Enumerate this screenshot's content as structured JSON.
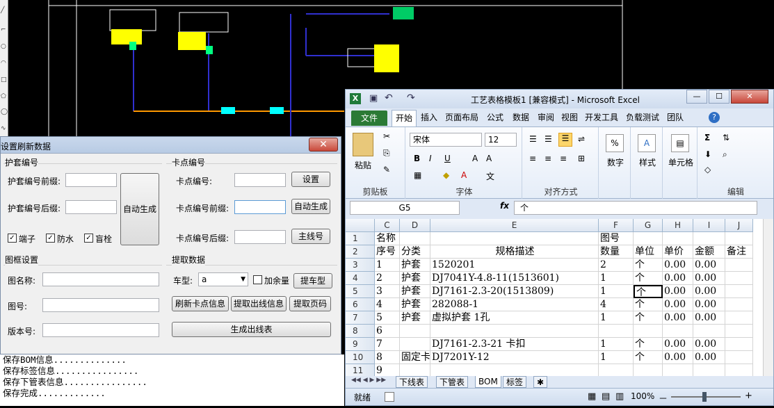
{
  "dialog": {
    "title": "设置刷新数据",
    "close_symbol": "✕",
    "sheath_group": {
      "title": "护套编号",
      "prefix_label": "护套编号前缀:",
      "suffix_label": "护套编号后缀:",
      "prefix_value": "",
      "suffix_value": "",
      "auto_button": "自动生成",
      "checkboxes": [
        {
          "label": "端子",
          "checked": true
        },
        {
          "label": "防水",
          "checked": true
        },
        {
          "label": "盲栓",
          "checked": true
        }
      ]
    },
    "card_group": {
      "title": "卡点编号",
      "number_label": "卡点编号:",
      "prefix_label": "卡点编号前缀:",
      "suffix_label": "卡点编号后缀:",
      "set_button": "设置",
      "auto_button": "自动生成",
      "main_wire_button": "主线号"
    },
    "frame_group": {
      "title": "图框设置",
      "name_label": "图名称:",
      "number_label": "图号:",
      "version_label": "版本号:"
    },
    "extract_group": {
      "title": "提取数据",
      "model_label": "车型:",
      "model_value": "a",
      "margin_label": "加余量",
      "margin_checked": false,
      "extract_model_button": "提车型",
      "refresh_card_button": "刷新卡点信息",
      "extract_out_button": "提取出线信息",
      "extract_page_button": "提取页码",
      "generate_button": "生成出线表"
    }
  },
  "log_lines": [
    "保存BOM信息..............",
    "保存标签信息................",
    "保存下管表信息................",
    "保存完成............."
  ],
  "excel": {
    "title": "工艺表格模板1  [兼容模式] - Microsoft Excel",
    "window_buttons": [
      "—",
      "☐",
      "✕"
    ],
    "tabs": [
      "文件",
      "开始",
      "插入",
      "页面布局",
      "公式",
      "数据",
      "审阅",
      "视图",
      "开发工具",
      "负载测试",
      "团队"
    ],
    "ribbon": {
      "paste": "粘贴",
      "clipboard": "剪贴板",
      "font_name": "宋体",
      "font_size": "12",
      "font_group": "字体",
      "align_group": "对齐方式",
      "number": "数字",
      "style": "样式",
      "cells": "单元格",
      "edit_group": "编辑",
      "bold": "B",
      "italic": "I",
      "underline": "U",
      "wen": "文"
    },
    "name_box": "G5",
    "fx": "fx",
    "formula": "个",
    "columns": [
      "C",
      "D",
      "E",
      "F",
      "G",
      "H",
      "I",
      "J"
    ],
    "rows": [
      {
        "n": "1",
        "c": "名称",
        "d": "",
        "e": "",
        "f": "图号",
        "g": "",
        "h": "",
        "i": "",
        "j": ""
      },
      {
        "n": "2",
        "c": "序号",
        "d": "分类",
        "e": "规格描述",
        "f": "数量",
        "g": "单位",
        "h": "单价",
        "i": "金额",
        "j": "备注"
      },
      {
        "n": "3",
        "c": "1",
        "d": "护套",
        "e": "1520201",
        "f": "2",
        "g": "个",
        "h": "0.00",
        "i": "0.00",
        "j": ""
      },
      {
        "n": "4",
        "c": "2",
        "d": "护套",
        "e": "DJ7041Y-4.8-11(1513601)",
        "f": "1",
        "g": "个",
        "h": "0.00",
        "i": "0.00",
        "j": ""
      },
      {
        "n": "5",
        "c": "3",
        "d": "护套",
        "e": "DJ7161-2.3-20(1513809)",
        "f": "1",
        "g": "个",
        "h": "0.00",
        "i": "0.00",
        "j": ""
      },
      {
        "n": "6",
        "c": "4",
        "d": "护套",
        "e": "282088-1",
        "f": "4",
        "g": "个",
        "h": "0.00",
        "i": "0.00",
        "j": ""
      },
      {
        "n": "7",
        "c": "5",
        "d": "护套",
        "e": "虚拟护套 1孔",
        "f": "1",
        "g": "个",
        "h": "0.00",
        "i": "0.00",
        "j": ""
      },
      {
        "n": "8",
        "c": "6",
        "d": "",
        "e": "",
        "f": "",
        "g": "",
        "h": "",
        "i": "",
        "j": ""
      },
      {
        "n": "9",
        "c": "7",
        "d": "",
        "e": "DJ7161-2.3-21 卡扣",
        "f": "1",
        "g": "个",
        "h": "0.00",
        "i": "0.00",
        "j": ""
      },
      {
        "n": "10",
        "c": "8",
        "d": "固定卡",
        "e": "DJ7201Y-12",
        "f": "1",
        "g": "个",
        "h": "0.00",
        "i": "0.00",
        "j": ""
      },
      {
        "n": "11",
        "c": "9",
        "d": "",
        "e": "",
        "f": "",
        "g": "",
        "h": "",
        "i": "",
        "j": ""
      }
    ],
    "sheet_tabs": [
      "下线表",
      "下管表",
      "BOM",
      "标签"
    ],
    "active_sheet": "BOM",
    "status": "就绪",
    "zoom": "100%",
    "zoom_minus": "－",
    "zoom_plus": "+"
  },
  "colors": {
    "cad_bg": "#000000",
    "cad_blue": "#3030d0",
    "cad_yellow": "#ffff00",
    "excel_file_tab": "#2b7a35",
    "close_red": "#c8473a"
  }
}
